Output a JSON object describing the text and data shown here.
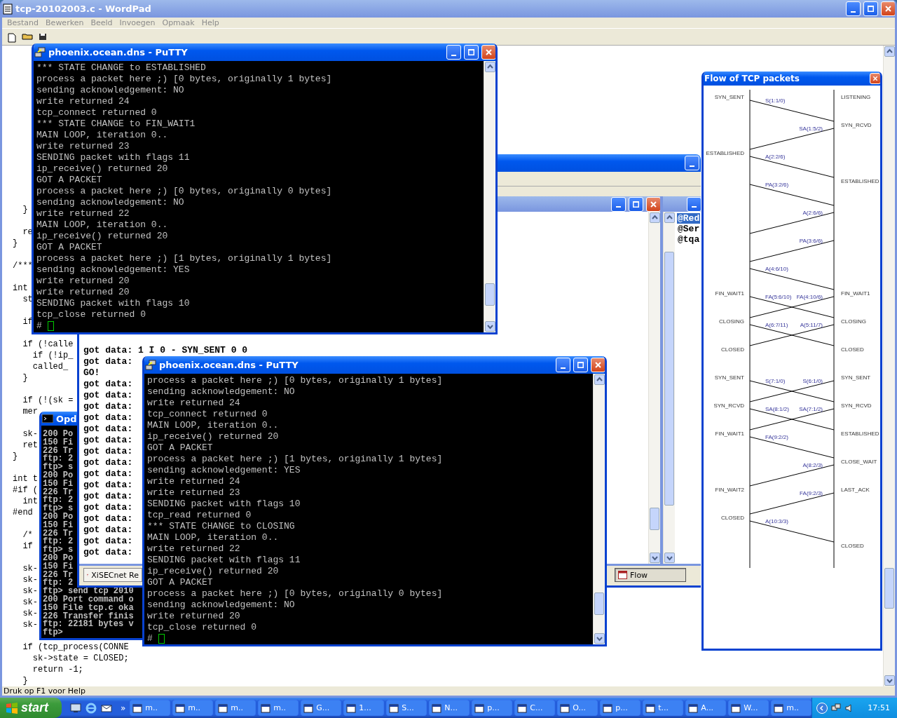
{
  "wordpad": {
    "title": "tcp-20102003.c - WordPad",
    "menu": [
      "Bestand",
      "Bewerken",
      "Beeld",
      "Invoegen",
      "Opmaak",
      "Help"
    ],
    "code_lines": [
      {
        "kind": "code",
        "text": "  }"
      },
      {
        "kind": "blank"
      },
      {
        "kind": "code",
        "text": "  re"
      },
      {
        "kind": "code",
        "text": "}"
      },
      {
        "kind": "blank"
      },
      {
        "kind": "code",
        "text": "/***"
      },
      {
        "kind": "blank"
      },
      {
        "kind": "code",
        "text": "int"
      },
      {
        "kind": "code",
        "text": "  st"
      },
      {
        "kind": "blank"
      },
      {
        "kind": "code",
        "text": "  if"
      },
      {
        "kind": "blank"
      },
      {
        "kind": "code",
        "text": "  if (!calle"
      },
      {
        "kind": "code",
        "text": "    if (!ip_"
      },
      {
        "kind": "code",
        "text": "    called_"
      },
      {
        "kind": "code",
        "text": "  }"
      },
      {
        "kind": "blank"
      },
      {
        "kind": "code",
        "text": "  if (!(sk ="
      },
      {
        "kind": "code",
        "text": "  mer"
      },
      {
        "kind": "blank"
      },
      {
        "kind": "code",
        "text": "  sk-"
      },
      {
        "kind": "code",
        "text": "  ret"
      },
      {
        "kind": "code",
        "text": "}"
      },
      {
        "kind": "blank"
      },
      {
        "kind": "code",
        "text": "int t"
      },
      {
        "kind": "code",
        "text": "#if ("
      },
      {
        "kind": "code",
        "text": "  int"
      },
      {
        "kind": "code",
        "text": "#end"
      },
      {
        "kind": "blank"
      },
      {
        "kind": "code",
        "text": "  /*"
      },
      {
        "kind": "code",
        "text": "  if"
      },
      {
        "kind": "blank"
      },
      {
        "kind": "code",
        "text": "  sk-"
      },
      {
        "kind": "code",
        "text": "  sk-"
      },
      {
        "kind": "code",
        "text": "  sk-"
      },
      {
        "kind": "code",
        "text": "  sk-"
      },
      {
        "kind": "code",
        "text": "  sk-"
      },
      {
        "kind": "code",
        "text": "  sk-"
      },
      {
        "kind": "blank"
      },
      {
        "kind": "code",
        "text": "  if (tcp_process(CONNE"
      },
      {
        "kind": "code",
        "text": "    sk->state = CLOSED;"
      },
      {
        "kind": "code",
        "text": "    return -1;"
      },
      {
        "kind": "code",
        "text": "  }"
      }
    ],
    "status": "Druk op F1 voor Help"
  },
  "ftp_window": {
    "title": "Opd",
    "lines": [
      "200 Po",
      "150 Fi",
      "226 Tr",
      "ftp: 2",
      "ftp> s",
      "200 Po",
      "150 Fi",
      "226 Tr",
      "ftp: 2",
      "ftp> s",
      "200 Po",
      "150 Fi",
      "226 Tr",
      "ftp: 2",
      "ftp> s",
      "200 Po",
      "150 Fi",
      "226 Tr",
      "ftp: 2",
      "ftp> send tcp 2010",
      "200 Port command o",
      "150 File tcp.c oka",
      "226 Transfer finis",
      "ftp: 22181 bytes v",
      "ftp>"
    ]
  },
  "xisec": {
    "log_lines": [
      "got data: 1 I 0 - SYN_SENT 0 0",
      "got data:",
      "GO!",
      "got data:",
      "got data:",
      "got data:",
      "got data:",
      "got data:",
      "got data:",
      "got data:",
      "got data:",
      "got data:",
      "got data:",
      "got data:",
      "got data:",
      "got data:",
      "got data:",
      "got data:",
      "got data:"
    ],
    "list_items": [
      {
        "text": "@Red",
        "selected": true
      },
      {
        "text": "@Ser",
        "selected": false
      },
      {
        "text": "@tqa",
        "selected": false
      }
    ],
    "window_buttons": [
      {
        "label": "XiSECnet Re",
        "selected": false
      },
      {
        "label": "Flow",
        "selected": true
      }
    ]
  },
  "putty_windows": [
    {
      "title": "phoenix.ocean.dns - PuTTY",
      "prompt": "#",
      "lines": [
        "*** STATE CHANGE to ESTABLISHED",
        "process a packet here ;) [0 bytes, originally 1 bytes]",
        "sending acknowledgement: NO",
        "write returned 24",
        "tcp_connect returned 0",
        "*** STATE CHANGE to FIN_WAIT1",
        "MAIN LOOP, iteration 0..",
        "write returned 23",
        "SENDING packet with flags 11",
        "ip_receive() returned 20",
        "GOT A PACKET",
        "process a packet here ;) [0 bytes, originally 0 bytes]",
        "sending acknowledgement: NO",
        "write returned 22",
        "MAIN LOOP, iteration 0..",
        "ip_receive() returned 20",
        "GOT A PACKET",
        "process a packet here ;) [1 bytes, originally 1 bytes]",
        "sending acknowledgement: YES",
        "write returned 20",
        "write returned 20",
        "SENDING packet with flags 10",
        "tcp_close returned 0"
      ]
    },
    {
      "title": "phoenix.ocean.dns - PuTTY",
      "prompt": "#",
      "lines": [
        "process a packet here ;) [0 bytes, originally 1 bytes]",
        "sending acknowledgement: NO",
        "write returned 24",
        "tcp_connect returned 0",
        "MAIN LOOP, iteration 0..",
        "ip_receive() returned 20",
        "GOT A PACKET",
        "process a packet here ;) [1 bytes, originally 1 bytes]",
        "sending acknowledgement: YES",
        "write returned 24",
        "write returned 23",
        "SENDING packet with flags 10",
        "tcp_read returned 0",
        "*** STATE CHANGE to CLOSING",
        "MAIN LOOP, iteration 0..",
        "write returned 22",
        "SENDING packet with flags 11",
        "ip_receive() returned 20",
        "GOT A PACKET",
        "process a packet here ;) [0 bytes, originally 0 bytes]",
        "sending acknowledgement: NO",
        "write returned 20",
        "tcp_close returned 0"
      ]
    }
  ],
  "flow_window": {
    "title": "Flow of TCP packets",
    "rows": [
      {
        "left": "SYN_SENT",
        "right": "LISTENING",
        "messages": [
          {
            "label": "S(1:1/0)",
            "kind": "rightward"
          }
        ]
      },
      {
        "right": "SYN_RCVD",
        "messages": [
          {
            "label": "SA(1:5/2)",
            "kind": "leftward"
          }
        ]
      },
      {
        "left": "ESTABLISHED",
        "messages": [
          {
            "label": "A(2:2/6)",
            "kind": "rightward"
          }
        ]
      },
      {
        "right": "ESTABLISHED",
        "messages": [
          {
            "label": "PA(3:2/6)",
            "kind": "rightward"
          }
        ]
      },
      {
        "messages": [
          {
            "label": "A(2:6/6)",
            "kind": "leftward"
          }
        ]
      },
      {
        "messages": [
          {
            "label": "PA(3:6/6)",
            "kind": "leftward"
          }
        ]
      },
      {
        "messages": [
          {
            "label": "A(4:6/10)",
            "kind": "rightward"
          }
        ]
      },
      {
        "left": "FIN_WAIT1",
        "right": "FIN_WAIT1",
        "messages": [
          {
            "label": "FA(5:6/10)",
            "kind": "rightward"
          },
          {
            "label": "FA(4:10/6)",
            "kind": "leftward"
          }
        ]
      },
      {
        "left": "CLOSING",
        "right": "CLOSING",
        "messages": [
          {
            "label": "A(6:7/11)",
            "kind": "rightward"
          },
          {
            "label": "A(5:11/7)",
            "kind": "leftward"
          }
        ]
      },
      {
        "left": "CLOSED",
        "right": "CLOSED",
        "messages": []
      },
      {
        "left": "SYN_SENT",
        "right": "SYN_SENT",
        "messages": [
          {
            "label": "S(7:1/0)",
            "kind": "rightward"
          },
          {
            "label": "S(6:1/0)",
            "kind": "leftward"
          }
        ]
      },
      {
        "left": "SYN_RCVD",
        "right": "SYN_RCVD",
        "messages": [
          {
            "label": "SA(8:1/2)",
            "kind": "rightward"
          },
          {
            "label": "SA(7:1/2)",
            "kind": "leftward"
          }
        ]
      },
      {
        "left": "FIN_WAIT1",
        "right": "ESTABLISHED",
        "messages": [
          {
            "label": "FA(9:2/2)",
            "kind": "rightward"
          }
        ]
      },
      {
        "right": "CLOSE_WAIT",
        "messages": [
          {
            "label": "A(8:2/3)",
            "kind": "leftward"
          }
        ]
      },
      {
        "left": "FIN_WAIT2",
        "right": "LAST_ACK",
        "messages": [
          {
            "label": "FA(9:2/3)",
            "kind": "leftward"
          }
        ]
      },
      {
        "left": "CLOSED",
        "messages": [
          {
            "label": "A(10:3/3)",
            "kind": "rightward"
          }
        ]
      },
      {
        "right": "CLOSED",
        "messages": []
      }
    ]
  },
  "taskbar": {
    "start": "start",
    "chevron": "»",
    "tasks": [
      "m..",
      "m..",
      "m..",
      "m..",
      "G...",
      "1...",
      "S...",
      "N...",
      "p...",
      "C...",
      "O...",
      "p...",
      "t...",
      "A...",
      "W...",
      "m.."
    ],
    "clock": "17:51"
  }
}
